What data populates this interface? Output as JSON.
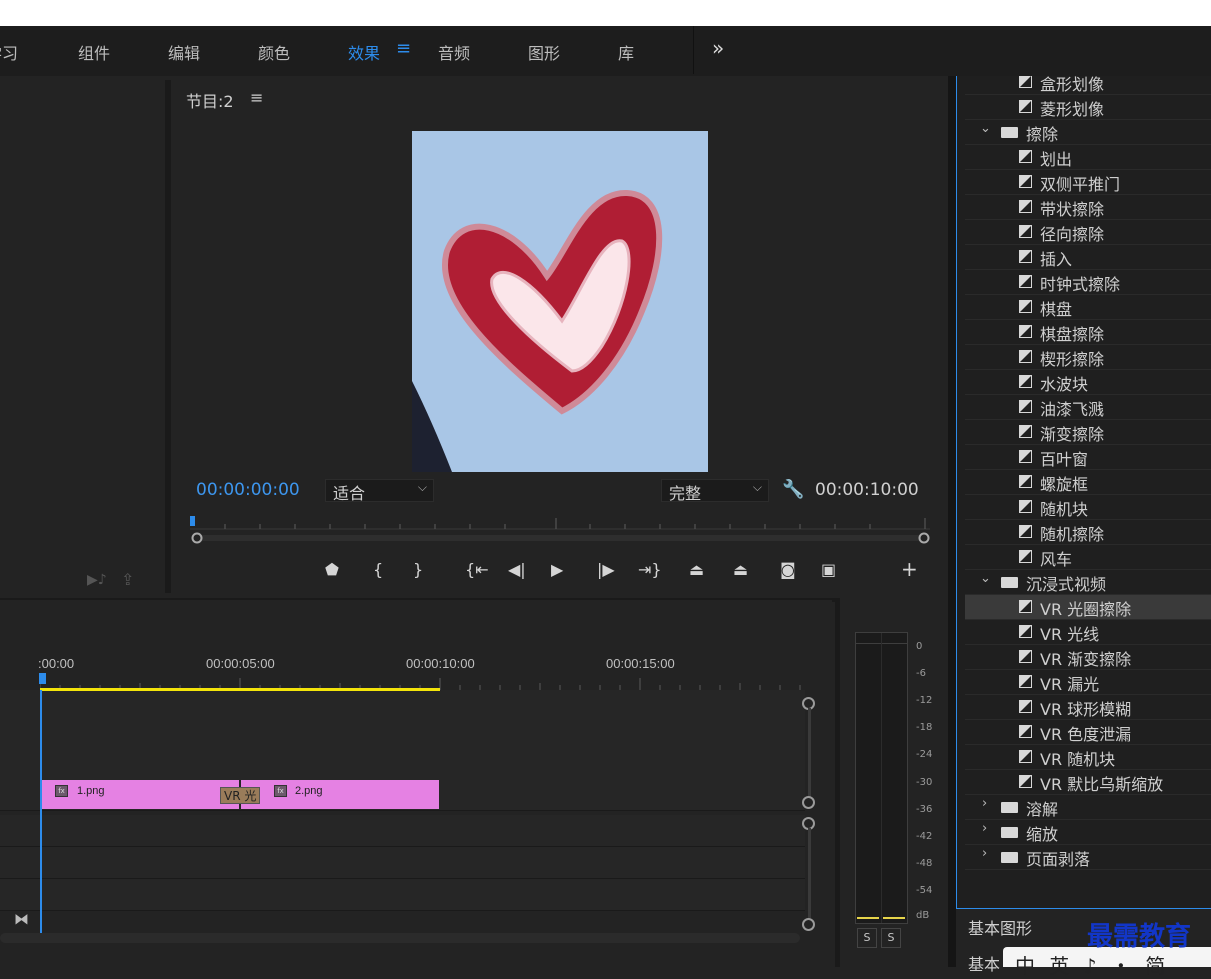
{
  "workspaces": [
    {
      "label": "学习"
    },
    {
      "label": "组件"
    },
    {
      "label": "编辑"
    },
    {
      "label": "颜色"
    },
    {
      "label": "效果"
    },
    {
      "label": "音频"
    },
    {
      "label": "图形"
    },
    {
      "label": "库"
    }
  ],
  "workspace_menu_icon": "≡",
  "workspace_more_icon": "»",
  "monitor": {
    "title": "节目:2",
    "menu_icon": "≡",
    "current_timecode": "00:00:00:00",
    "fit_value": "适合",
    "quality_value": "完整",
    "duration_timecode": "00:00:10:00"
  },
  "timeline": {
    "ruler_labels": [
      ":00:00",
      "00:00:05:00",
      "00:00:10:00",
      "00:00:15:00"
    ],
    "clips": [
      {
        "name": "1.png",
        "fx": "fx"
      },
      {
        "name": "2.png",
        "fx": "fx"
      }
    ],
    "transition_label": "VR 光"
  },
  "meter": {
    "db_labels": [
      "0",
      "-6",
      "-12",
      "-18",
      "-24",
      "-30",
      "-36",
      "-42",
      "-48",
      "-54",
      "dB"
    ],
    "solo_buttons": [
      "S",
      "S"
    ]
  },
  "effects": {
    "items": [
      {
        "type": "effect",
        "label": "盒形划像"
      },
      {
        "type": "effect",
        "label": "菱形划像"
      },
      {
        "type": "folder",
        "label": "擦除",
        "expanded": true
      },
      {
        "type": "effect",
        "label": "划出"
      },
      {
        "type": "effect",
        "label": "双侧平推门"
      },
      {
        "type": "effect",
        "label": "带状擦除"
      },
      {
        "type": "effect",
        "label": "径向擦除"
      },
      {
        "type": "effect",
        "label": "插入"
      },
      {
        "type": "effect",
        "label": "时钟式擦除"
      },
      {
        "type": "effect",
        "label": "棋盘"
      },
      {
        "type": "effect",
        "label": "棋盘擦除"
      },
      {
        "type": "effect",
        "label": "楔形擦除"
      },
      {
        "type": "effect",
        "label": "水波块"
      },
      {
        "type": "effect",
        "label": "油漆飞溅"
      },
      {
        "type": "effect",
        "label": "渐变擦除"
      },
      {
        "type": "effect",
        "label": "百叶窗"
      },
      {
        "type": "effect",
        "label": "螺旋框"
      },
      {
        "type": "effect",
        "label": "随机块"
      },
      {
        "type": "effect",
        "label": "随机擦除"
      },
      {
        "type": "effect",
        "label": "风车"
      },
      {
        "type": "folder",
        "label": "沉浸式视频",
        "expanded": true
      },
      {
        "type": "effect",
        "label": "VR 光圈擦除",
        "selected": true
      },
      {
        "type": "effect",
        "label": "VR 光线"
      },
      {
        "type": "effect",
        "label": "VR 渐变擦除"
      },
      {
        "type": "effect",
        "label": "VR 漏光"
      },
      {
        "type": "effect",
        "label": "VR 球形模糊"
      },
      {
        "type": "effect",
        "label": "VR 色度泄漏"
      },
      {
        "type": "effect",
        "label": "VR 随机块"
      },
      {
        "type": "effect",
        "label": "VR 默比乌斯缩放"
      },
      {
        "type": "folder",
        "label": "溶解",
        "expanded": false
      },
      {
        "type": "folder",
        "label": "缩放",
        "expanded": false
      },
      {
        "type": "folder",
        "label": "页面剥落",
        "expanded": false
      }
    ]
  },
  "panels": {
    "basic_graphics": "基本图形",
    "basic_second": "基本"
  },
  "watermark": "最需教育",
  "ime_text": "中 英 ♪ ・ 简",
  "colors": {
    "accent": "#2d8ceb",
    "clip": "#e581e3",
    "work_area": "#f3e40a",
    "watermark": "#1236c8"
  }
}
